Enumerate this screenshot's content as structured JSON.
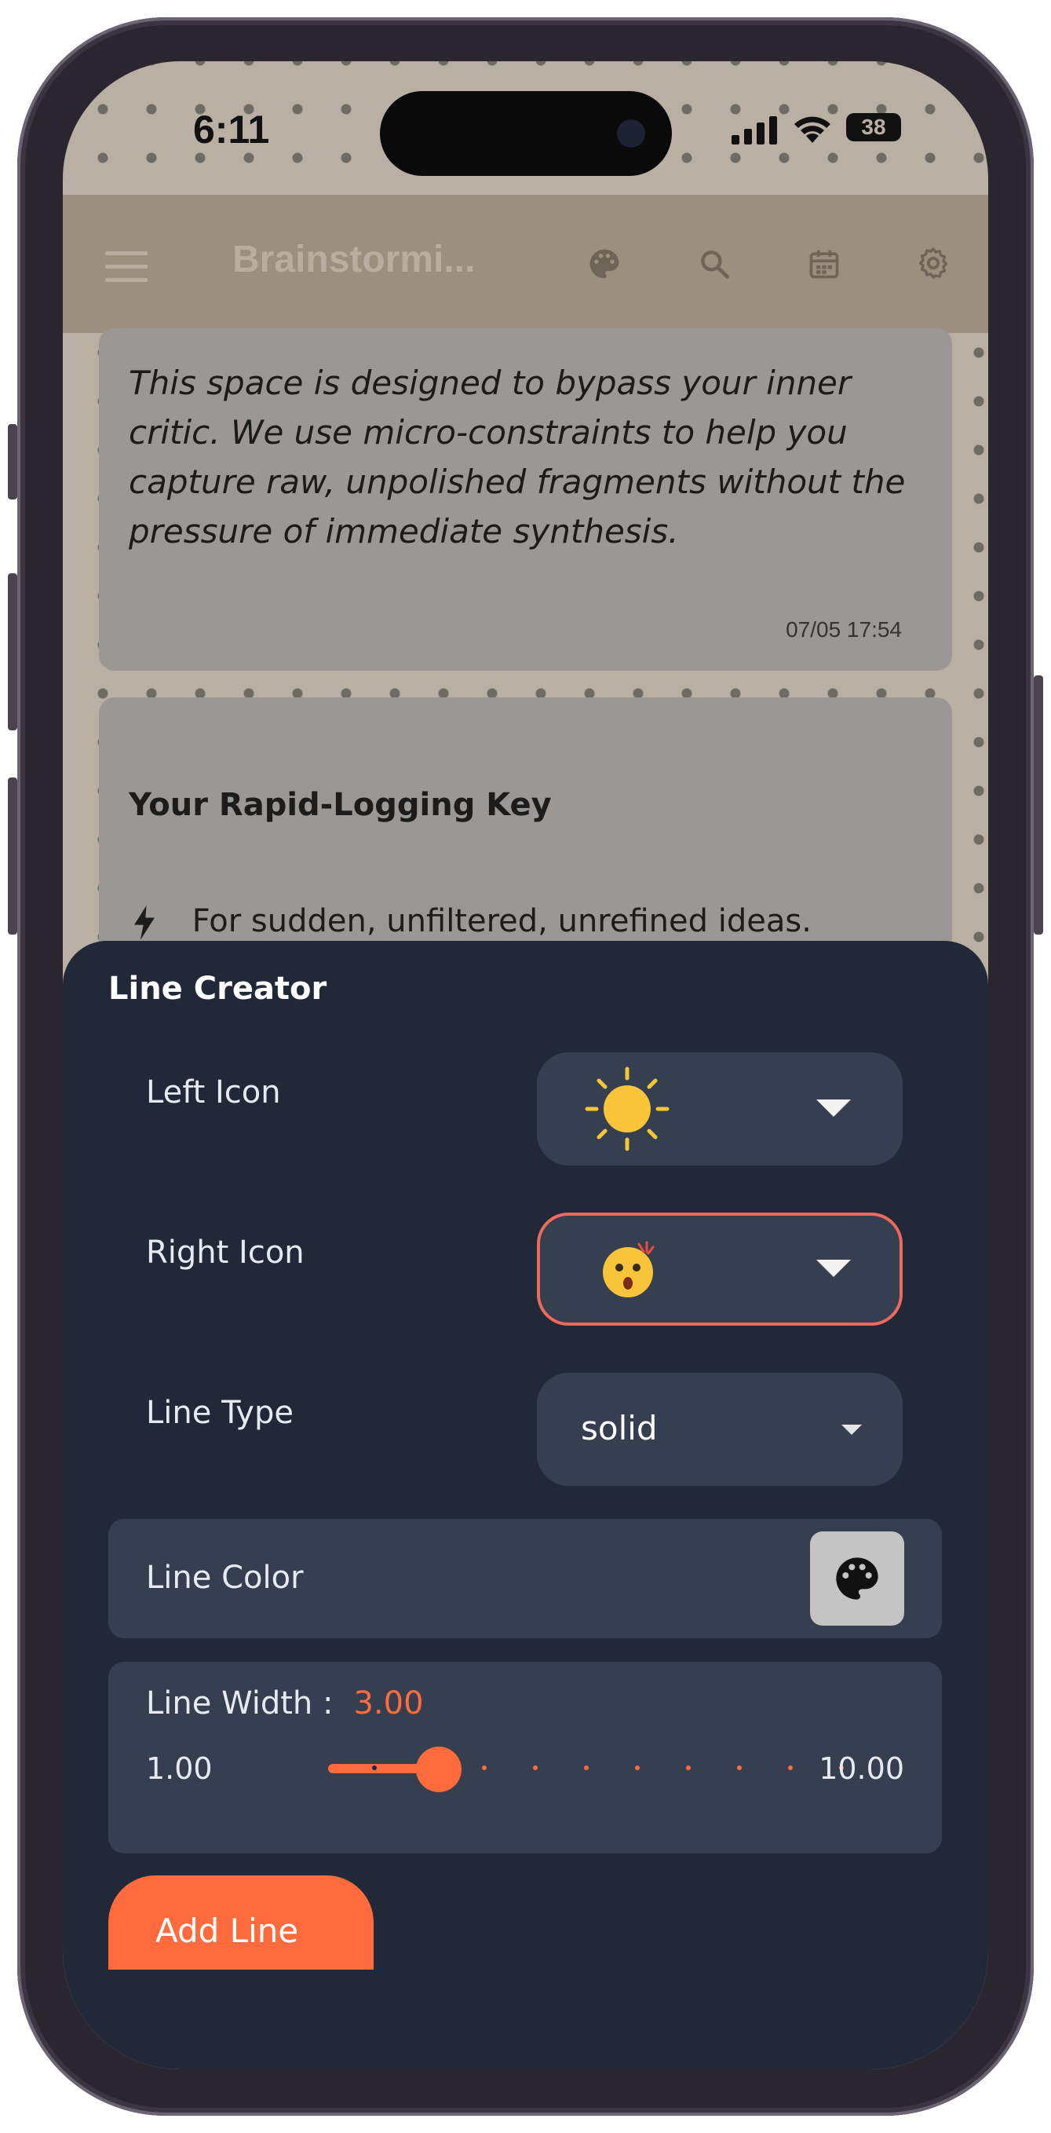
{
  "status": {
    "time": "6:11",
    "battery": "38"
  },
  "appbar": {
    "title": "Brainstormi..."
  },
  "notes": {
    "intro": {
      "body": "This space is designed to bypass your inner critic. We use micro-constraints to help you capture raw, unpolished fragments without the pressure of immediate synthesis.",
      "timestamp": "07/05 17:54"
    },
    "key": {
      "heading": "Your Rapid-Logging Key",
      "item": "For sudden, unfiltered, unrefined ideas."
    }
  },
  "sheet": {
    "title": "Line Creator",
    "left_icon": {
      "label": "Left Icon",
      "icon": "sun-icon"
    },
    "right_icon": {
      "label": "Right Icon",
      "icon": "surprised-face-icon"
    },
    "line_type": {
      "label": "Line Type",
      "value": "solid"
    },
    "line_color": {
      "label": "Line Color"
    },
    "line_width": {
      "label": "Line Width :",
      "value": "3.00",
      "min": "1.00",
      "max": "10.00",
      "fraction": 0.2222
    },
    "add_button": "Add Line"
  },
  "colors": {
    "accent": "#ff6b3d",
    "sheet_bg": "#212938",
    "control_bg": "#353f50",
    "focus_border": "#ef6a5c"
  }
}
